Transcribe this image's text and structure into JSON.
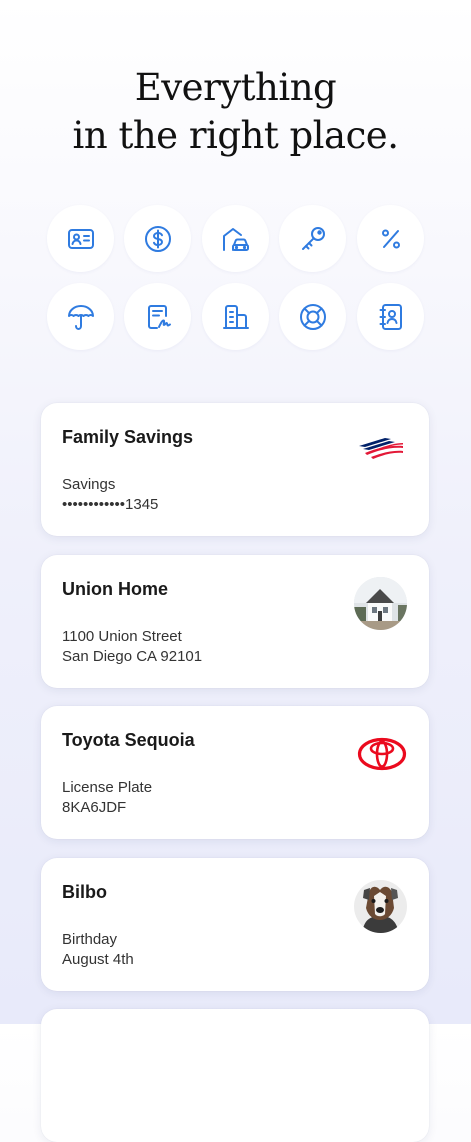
{
  "headline": {
    "line1": "Everything",
    "line2": "in the right place."
  },
  "category_icons": [
    "id-card-icon",
    "dollar-coin-icon",
    "home-car-icon",
    "key-icon",
    "percent-icon",
    "umbrella-icon",
    "signed-document-icon",
    "buildings-icon",
    "lifebuoy-icon",
    "contact-book-icon"
  ],
  "cards": [
    {
      "title": "Family Savings",
      "line1": "Savings",
      "line2": "••••••••••••1345",
      "logo": "bank-of-america-logo"
    },
    {
      "title": "Union Home",
      "line1": "1100 Union Street",
      "line2": "San Diego CA 92101",
      "logo": "house-photo"
    },
    {
      "title": "Toyota Sequoia",
      "line1": "License Plate",
      "line2": "8KA6JDF",
      "logo": "toyota-logo"
    },
    {
      "title": "Bilbo",
      "line1": "Birthday",
      "line2": "August 4th",
      "logo": "dog-photo"
    }
  ],
  "colors": {
    "icon_blue": "#2f7be0",
    "boa_red": "#e31837",
    "boa_blue": "#012169",
    "toyota_red": "#eb0a1e"
  }
}
